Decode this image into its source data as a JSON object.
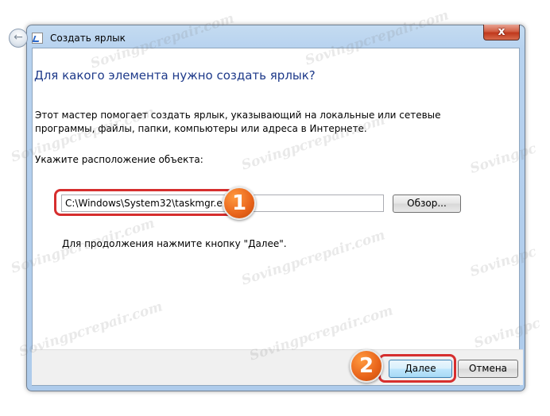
{
  "window": {
    "title": "Создать ярлык",
    "close_label": "x"
  },
  "content": {
    "heading": "Для какого элемента нужно создать ярлык?",
    "description": "Этот мастер помогает создать ярлык, указывающий на локальные или сетевые программы, файлы, папки, компьютеры или адреса в Интернете.",
    "location_label": "Укажите расположение объекта:",
    "location_value": "C:\\Windows\\System32\\taskmgr.exe",
    "browse_label": "Обзор...",
    "hint": "Для продолжения нажмите кнопку \"Далее\"."
  },
  "footer": {
    "next_label": "Далее",
    "cancel_label": "Отмена"
  },
  "annotations": {
    "step1": "1",
    "step2": "2"
  },
  "watermark": {
    "text": "Sovingpcrepair.com",
    "short": "Sovingpc"
  },
  "colors": {
    "heading": "#1e3a8a",
    "highlight": "#d62e2e",
    "badge": "#e8631a"
  },
  "icons": {
    "back": "back-arrow-icon",
    "shortcut": "shortcut-icon",
    "close": "close-icon"
  }
}
